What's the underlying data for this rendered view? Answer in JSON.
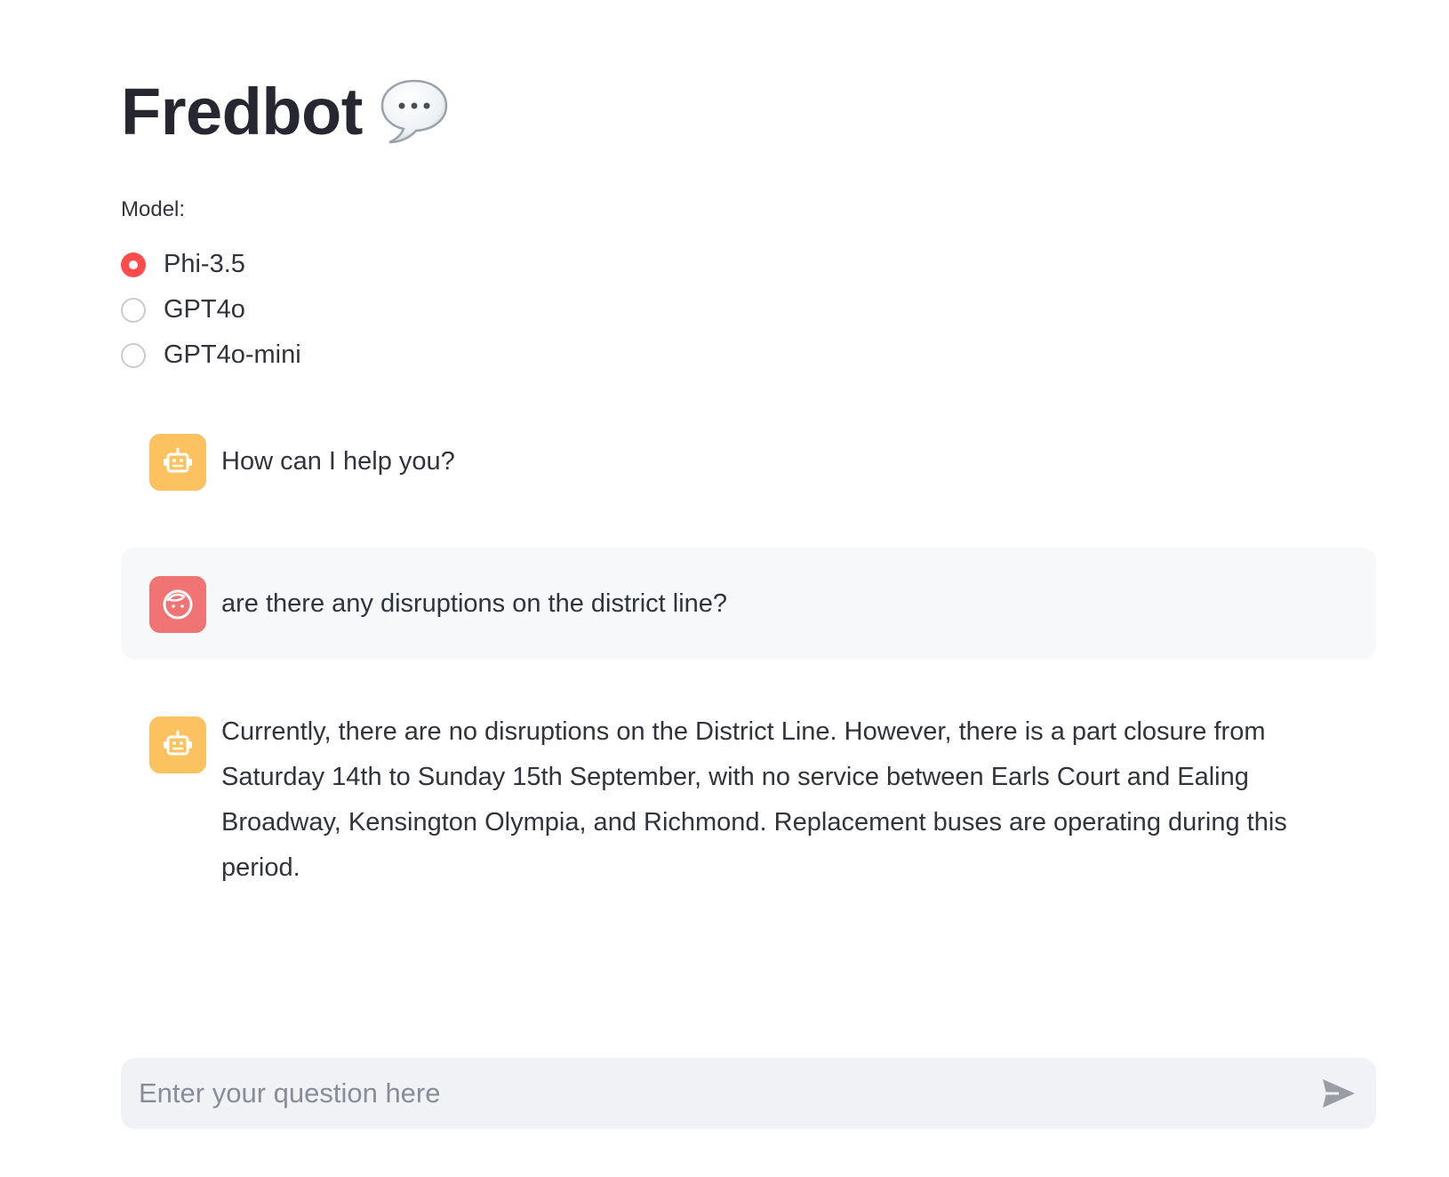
{
  "header": {
    "title": "Fredbot",
    "title_icon": "speech-bubble-icon"
  },
  "model_selector": {
    "label": "Model:",
    "options": [
      {
        "label": "Phi-3.5",
        "selected": true
      },
      {
        "label": "GPT4o",
        "selected": false
      },
      {
        "label": "GPT4o-mini",
        "selected": false
      }
    ],
    "accent_color": "#ff4b4b"
  },
  "messages": [
    {
      "role": "assistant",
      "icon": "robot-icon",
      "text": "How can I help you?"
    },
    {
      "role": "user",
      "icon": "user-face-icon",
      "text": "are there any disruptions on the district line?"
    },
    {
      "role": "assistant",
      "icon": "robot-icon",
      "text": "Currently, there are no disruptions on the District Line. However, there is a part closure from Saturday 14th to Sunday 15th September, with no service between Earls Court and Ealing Broadway, Kensington Olympia, and Richmond. Replacement buses are operating during this period."
    }
  ],
  "chat_input": {
    "placeholder": "Enter your question here",
    "value": "",
    "send_icon": "send-icon"
  },
  "colors": {
    "assistant_avatar": "#fbc25f",
    "user_avatar": "#f17474",
    "user_message_bg": "#f7f8fa",
    "input_bg": "#f0f2f6"
  }
}
